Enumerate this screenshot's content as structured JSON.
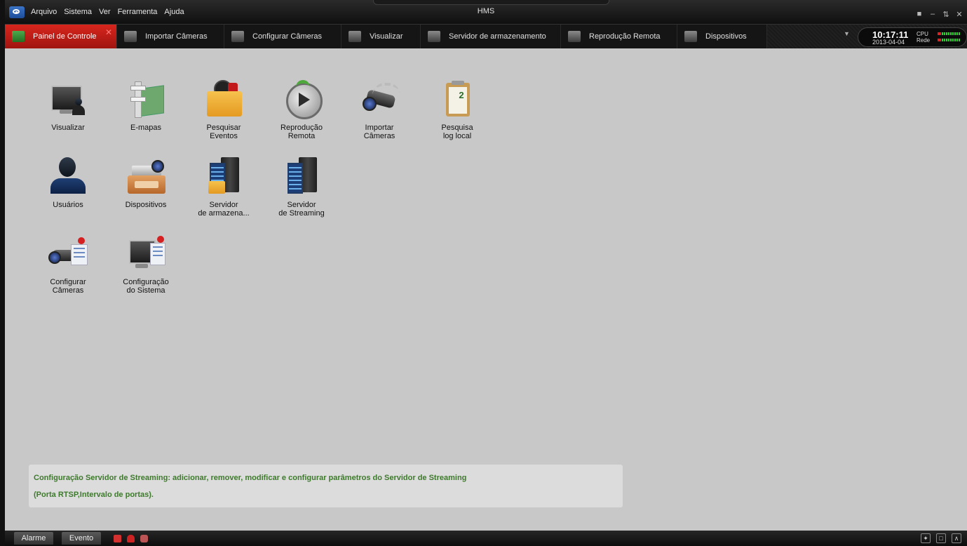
{
  "window": {
    "title": "HMS",
    "controls": [
      "lock-icon",
      "minimize-icon",
      "restore-icon",
      "close-icon"
    ]
  },
  "menu": [
    "Arquivo",
    "Sistema",
    "Ver",
    "Ferramenta",
    "Ajuda"
  ],
  "tabs": [
    {
      "label": "Painel de Controle",
      "icon": "control-panel-icon",
      "active": true
    },
    {
      "label": "Importar Câmeras",
      "icon": "import-cameras-icon",
      "active": false
    },
    {
      "label": "Configurar Câmeras",
      "icon": "configure-cameras-icon",
      "active": false
    },
    {
      "label": "Visualizar",
      "icon": "live-view-icon",
      "active": false
    },
    {
      "label": "Servidor de armazenamento",
      "icon": "nvr-icon",
      "active": false
    },
    {
      "label": "Reprodução Remota",
      "icon": "remote-playback-icon",
      "active": false
    },
    {
      "label": "Dispositivos",
      "icon": "devices-icon",
      "active": false
    }
  ],
  "status_panel": {
    "time": "10:17:11",
    "date": "2013-04-04",
    "cpu_label": "CPU",
    "network_label": "Rede"
  },
  "dashboard": [
    {
      "label": "Visualizar",
      "icon": "monitor-icon"
    },
    {
      "label": "E-mapas",
      "icon": "map-icon"
    },
    {
      "label": "Pesquisar\nEventos",
      "icon": "event-search-icon"
    },
    {
      "label": "Reprodução\nRemota",
      "icon": "playback-icon"
    },
    {
      "label": "Importar\nCâmeras",
      "icon": "camera-import-icon"
    },
    {
      "label": "Pesquisa\nlog local",
      "icon": "log-search-icon"
    },
    {
      "label": "Usuários",
      "icon": "users-icon"
    },
    {
      "label": "Dispositivos",
      "icon": "devices-drawer-icon"
    },
    {
      "label": "Servidor\nde armazena...",
      "icon": "storage-server-icon"
    },
    {
      "label": "Servidor\nde Streaming",
      "icon": "streaming-server-icon"
    },
    {
      "label": "Configurar\nCâmeras",
      "icon": "camera-config-icon"
    },
    {
      "label": "Configuração\ndo Sistema",
      "icon": "system-config-icon"
    }
  ],
  "description": {
    "line1": "Configuração Servidor de Streaming: adicionar, remover, modificar e configurar parâmetros do Servidor de Streaming",
    "line2": "(Porta RTSP,Intervalo de portas)."
  },
  "statusbar": {
    "alarm_tab": "Alarme",
    "event_tab": "Evento"
  }
}
